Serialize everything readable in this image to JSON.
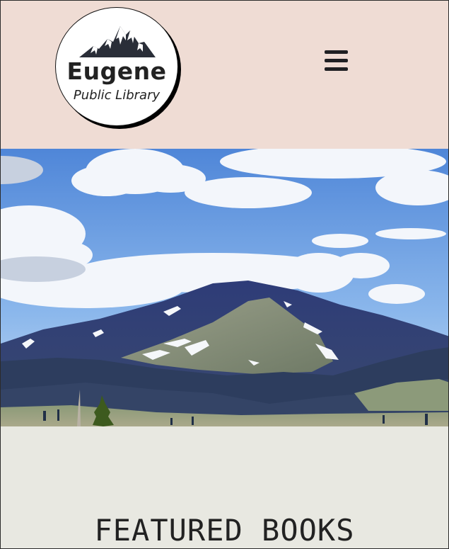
{
  "header": {
    "logo_title": "Eugene",
    "logo_subtitle": "Public Library",
    "logo_icon": "mountain-icon",
    "menu_icon": "hamburger-menu-icon"
  },
  "hero": {
    "image": "mountain-landscape"
  },
  "featured": {
    "heading": "FEATURED BOOKS"
  },
  "colors": {
    "header_bg": "#efdcd4",
    "section_bg": "#e8e8e1",
    "text": "#222222"
  }
}
